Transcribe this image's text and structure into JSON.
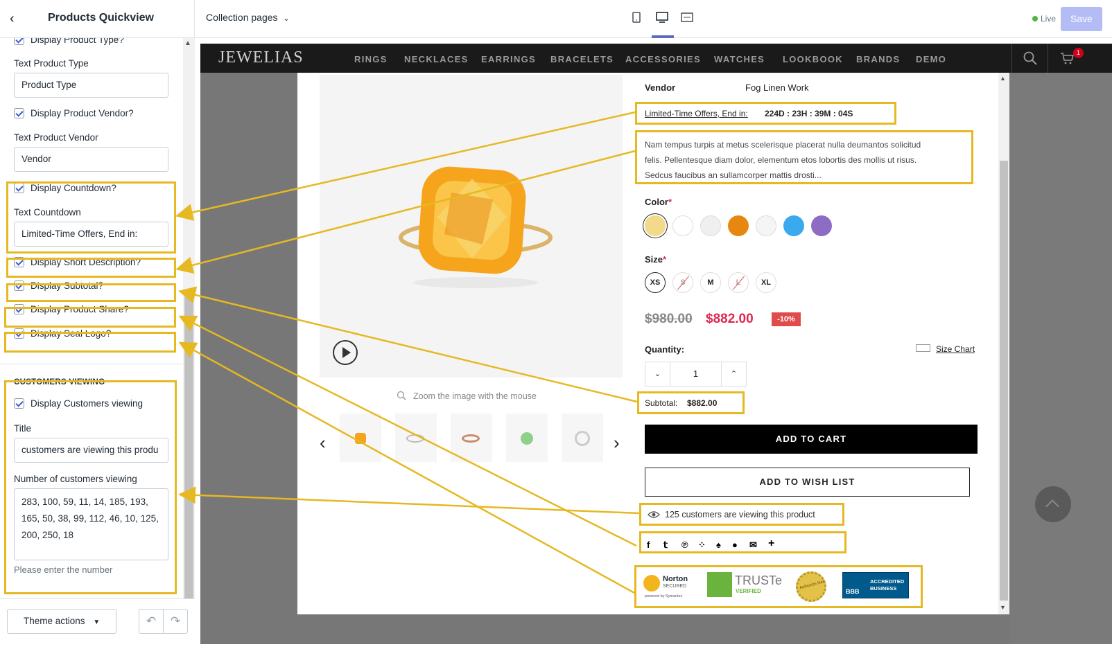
{
  "left_panel": {
    "title": "Products Quickview",
    "items": {
      "display_product_type": "Display Product Type?",
      "text_product_type_label": "Text Product Type",
      "text_product_type_value": "Product Type",
      "display_product_vendor": "Display Product Vendor?",
      "text_product_vendor_label": "Text Product Vendor",
      "text_product_vendor_value": "Vendor",
      "display_countdown": "Display Countdown?",
      "text_countdown_label": "Text Countdown",
      "text_countdown_value": "Limited-Time Offers, End in:",
      "display_short_description": "Display Short Description?",
      "display_subtotal": "Display Subtotal?",
      "display_product_share": "Display Product Share?",
      "display_seal_logo": "Display Seal Logo?"
    },
    "customers_viewing": {
      "heading": "CUSTOMERS VIEWING",
      "display_label": "Display Customers viewing",
      "title_label": "Title",
      "title_value": "customers are viewing this produ",
      "number_label": "Number of customers viewing",
      "numbers_line1": "283, 100, 59, 11, 14, 185, 193,",
      "numbers_line2": "165, 50, 38, 99, 112, 46, 10, 125,",
      "numbers_line3": "200, 250, 18",
      "hint": "Please enter the number"
    },
    "footer": {
      "theme_actions": "Theme actions"
    }
  },
  "topbar": {
    "page_selector": "Collection pages",
    "live": "Live",
    "save": "Save"
  },
  "store": {
    "logo": "JEWELIAS",
    "nav": [
      "RINGS",
      "NECKLACES",
      "EARRINGS",
      "BRACELETS",
      "ACCESSORIES",
      "WATCHES",
      "LOOKBOOK",
      "BRANDS",
      "DEMO"
    ],
    "cart_count": "1"
  },
  "product": {
    "vendor_label": "Vendor",
    "vendor_value": "Fog Linen Work",
    "countdown_label": "Limited-Time Offers, End in:",
    "countdown_value": "224D : 23H : 39M : 04S",
    "description_line1": "Nam tempus turpis at metus scelerisque placerat nulla deumantos solicitud",
    "description_line2": "felis. Pellentesque diam dolor, elementum etos lobortis des mollis ut risus.",
    "description_line3": "Sedcus faucibus an sullamcorper mattis drosti...",
    "color_label": "Color",
    "colors": [
      "#f3d98a",
      "#ffffff",
      "#efefef",
      "#e8870f",
      "#f5f5f5",
      "#3aa9ee",
      "#8c6cc4"
    ],
    "size_label": "Size",
    "sizes": [
      "XS",
      "S",
      "M",
      "L",
      "XL"
    ],
    "old_price": "$980.00",
    "price": "$882.00",
    "discount": "-10%",
    "quantity_label": "Quantity:",
    "quantity_value": "1",
    "size_chart": "Size Chart",
    "subtotal_label": "Subtotal:",
    "subtotal_value": "$882.00",
    "add_to_cart": "ADD TO CART",
    "add_to_wishlist": "ADD TO WISH LIST",
    "viewing": "125 customers are viewing this product",
    "zoom_hint": "Zoom the image with the mouse",
    "seals": {
      "norton": "Norton",
      "norton_sub": "SECURED",
      "norton_powered": "powered by Symantec",
      "truste": "TRUSTe",
      "truste_sub": "VERIFIED",
      "authorize": "Authorize.Net",
      "bbb": "BBB",
      "bbb_text": "ACCREDITED BUSINESS"
    }
  },
  "accent_colors": {
    "highlight": "#e6b822",
    "sale_price": "#e0284f",
    "discount_badge": "#e04b4b",
    "save_button": "#b3bcf5"
  }
}
